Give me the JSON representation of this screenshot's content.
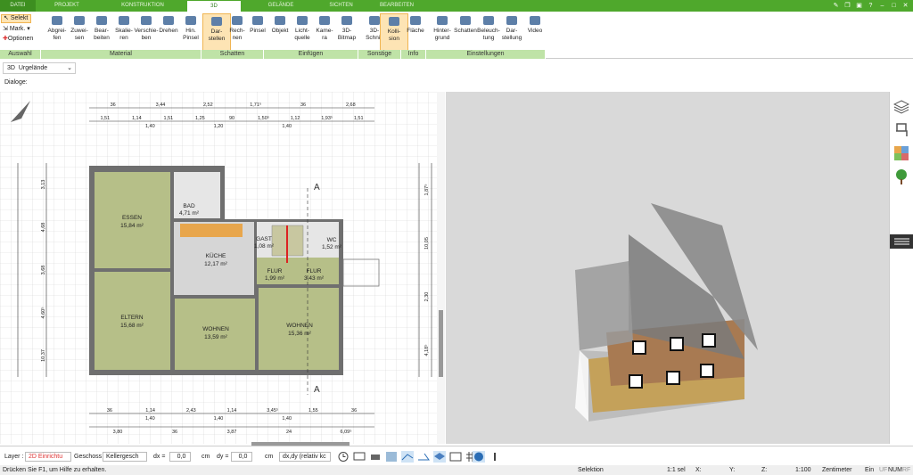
{
  "tabs": [
    "DATEI",
    "PROJEKT",
    "KONSTRUKTION",
    "3D",
    "GELÄNDE",
    "SICHTEN",
    "BEARBEITEN"
  ],
  "auswahl": {
    "selekt": "Selekt",
    "mark": "Mark.",
    "optionen": "Optionen"
  },
  "ribbon": {
    "material": [
      [
        "Abgrei-",
        "fen"
      ],
      [
        "Zuwei-",
        "sen"
      ],
      [
        "Bear-",
        "beiten"
      ],
      [
        "Skalie-",
        "ren"
      ],
      [
        "Verschie-",
        "ben"
      ],
      [
        "Drehen",
        ""
      ],
      [
        "Hin.",
        "Pinsel"
      ]
    ],
    "schatten": [
      [
        "Dar-",
        "stellen"
      ],
      [
        "Rech-",
        "nen"
      ],
      [
        "Pinsel",
        ""
      ]
    ],
    "einfuegen": [
      [
        "Objekt",
        ""
      ],
      [
        "Licht-",
        "quelle"
      ],
      [
        "Kame-",
        "ra"
      ],
      [
        "3D-",
        "Bitmap"
      ]
    ],
    "sonstige": [
      [
        "3D-",
        "Schnitt"
      ],
      [
        "Kolli-",
        "sion"
      ]
    ],
    "info": [
      [
        "Fläche",
        ""
      ]
    ],
    "einstellungen": [
      [
        "Hinter-",
        "grund"
      ],
      [
        "Schatten",
        ""
      ],
      [
        "Beleuch-",
        "tung"
      ],
      [
        "Dar-",
        "stellung"
      ],
      [
        "Video",
        ""
      ]
    ]
  },
  "groups": [
    "Auswahl",
    "Material",
    "Schatten",
    "Einfügen",
    "Sonstige",
    "Info",
    "Einstellungen"
  ],
  "view_select": {
    "mode": "3D",
    "value": "Urgelände"
  },
  "dialoge": "Dialoge:",
  "rooms": [
    {
      "name": "ESSEN",
      "area": "15,84 m²"
    },
    {
      "name": "BAD",
      "area": "4,71 m²"
    },
    {
      "name": "KÜCHE",
      "area": "12,17 m²"
    },
    {
      "name": "FLUR",
      "area": "1,99 m²"
    },
    {
      "name": "FLUR",
      "area": "3,43 m²"
    },
    {
      "name": "ELTERN",
      "area": "15,68 m²"
    },
    {
      "name": "WOHNEN",
      "area": "13,59 m²"
    },
    {
      "name": "WOHNEN",
      "area": "15,36 m²"
    },
    {
      "name": "GAST",
      "area": "1,08 m²"
    },
    {
      "name": "WC",
      "area": "1,52 m²"
    }
  ],
  "section_marker": "A",
  "dims_top1": [
    "36",
    "3,44",
    "2,52",
    "1,71⁵",
    "36",
    "2,68"
  ],
  "dims_top2": [
    "1,51",
    "1,14",
    "1,51",
    "1,25",
    "90",
    "1,50⁵",
    "1,12",
    "1,93⁵",
    "1,51"
  ],
  "dims_top2b": [
    "1,40",
    "1,20",
    "1,40"
  ],
  "dims_bot1": [
    "36",
    "1,14",
    "2,43",
    "1,14",
    "3,45⁵",
    "1,55",
    "36"
  ],
  "dims_bot1b": [
    "1,40",
    "1,40",
    "1,40"
  ],
  "dims_bot2": [
    "3,80",
    "36",
    "3,87",
    "24",
    "6,09⁵"
  ],
  "dims_left": [
    "3,13",
    "4,68",
    "3,68",
    "4,60⁵",
    "10,37"
  ],
  "dims_right": [
    "1,87⁵",
    "10,05",
    "2,30",
    "4,18⁵"
  ],
  "status": {
    "layer_label": "Layer :",
    "layer_value": "2D Einrichtu",
    "geschoss_label": "Geschoss :",
    "geschoss_value": "Kellergesch",
    "dx_label": "dx =",
    "dx_value": "0,0",
    "unit1": "cm",
    "dy_label": "dy =",
    "dy_value": "0,0",
    "unit2": "cm",
    "mode_value": "dx,dy (relativ kc"
  },
  "statusbar": {
    "help": "Drücken Sie F1, um Hilfe zu erhalten.",
    "selektion": "Selektion",
    "scale": "1:1 sel",
    "x": "X:",
    "y": "Y:",
    "z": "Z:",
    "scale2": "1:100",
    "units": "Zentimeter",
    "ein": "Ein",
    "uf": "UF",
    "num": "NUM",
    "rf": "RF"
  },
  "colors": {
    "ribbon_green": "#4fa82c",
    "group_green": "#bfe3a7",
    "active_orange": "#fde4b4",
    "room_fill": "#b6bf88",
    "wall": "#666666",
    "kitchen": "#e8a64c"
  }
}
